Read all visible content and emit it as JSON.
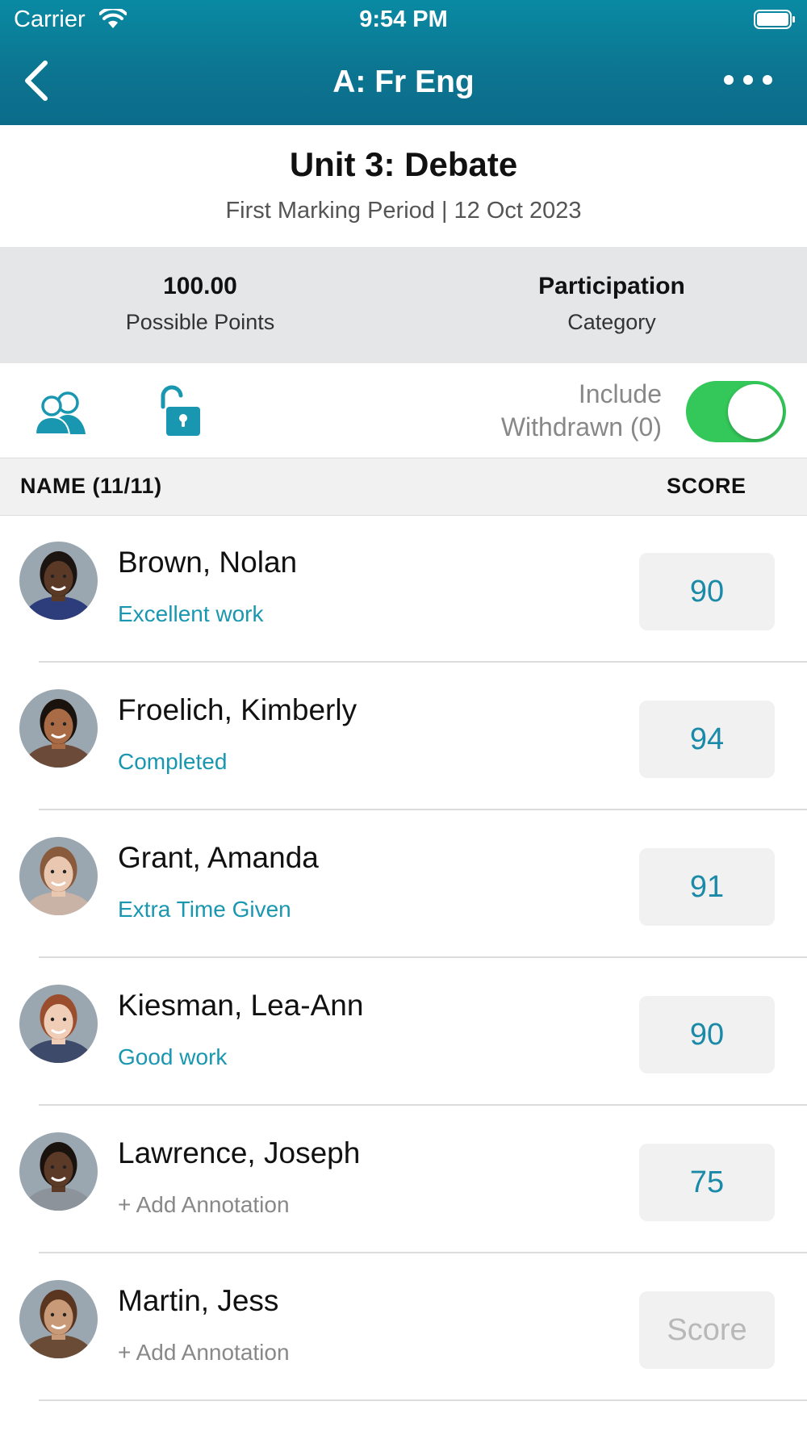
{
  "status_bar": {
    "carrier": "Carrier",
    "time": "9:54 PM"
  },
  "nav": {
    "title": "A: Fr Eng"
  },
  "assignment": {
    "title": "Unit 3: Debate",
    "subtitle": "First Marking Period | 12 Oct 2023",
    "possible_points_value": "100.00",
    "possible_points_label": "Possible Points",
    "category_value": "Participation",
    "category_label": "Category"
  },
  "controls": {
    "include_withdrawn_line1": "Include",
    "include_withdrawn_line2": "Withdrawn (0)",
    "include_withdrawn_on": true
  },
  "table": {
    "name_header": "NAME  (11/11)",
    "score_header": "SCORE"
  },
  "students": [
    {
      "name": "Brown, Nolan",
      "annotation": "Excellent work",
      "score": "90",
      "skin": "#5a3a26",
      "hair": "#1c1410",
      "shirt": "#2d3c7a"
    },
    {
      "name": "Froelich, Kimberly",
      "annotation": "Completed",
      "score": "94",
      "skin": "#a86b45",
      "hair": "#1a120d",
      "shirt": "#6b4a3a"
    },
    {
      "name": "Grant, Amanda",
      "annotation": "Extra Time Given",
      "score": "91",
      "skin": "#e9c7b0",
      "hair": "#8a5a3c",
      "shirt": "#c9b2a6"
    },
    {
      "name": "Kiesman, Lea-Ann",
      "annotation": "Good work",
      "score": "90",
      "skin": "#efcdb6",
      "hair": "#9b4e2e",
      "shirt": "#3e4a6a"
    },
    {
      "name": "Lawrence, Joseph",
      "annotation": "+ Add Annotation",
      "score": "75",
      "skin": "#5b3a27",
      "hair": "#1a120d",
      "shirt": "#8c939a"
    },
    {
      "name": "Martin, Jess",
      "annotation": "+ Add Annotation",
      "score": "Score",
      "skin": "#c99a78",
      "hair": "#5a3520",
      "shirt": "#6a4b35"
    }
  ],
  "colors": {
    "accent": "#1a97b0",
    "header": "#0c7490",
    "toggle_on": "#34c759"
  }
}
